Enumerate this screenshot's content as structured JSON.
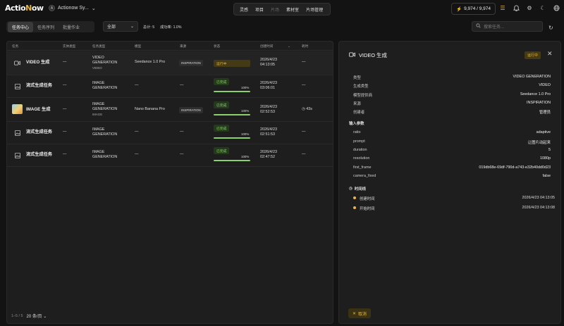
{
  "app": {
    "logo_prefix": "Actio",
    "logo_n": "N",
    "logo_suffix": "ow",
    "workspace_initial": "A",
    "workspace_name": "Actionow Sy..."
  },
  "nav": {
    "items": [
      "灵感",
      "项目",
      "片场",
      "素材室",
      "片场管理"
    ]
  },
  "credits": {
    "value": "9,974 / 9,974"
  },
  "toolbar": {
    "tabs": [
      "任务中心",
      "任务序列",
      "批量作业"
    ],
    "filter": "全部",
    "stats_total": "总计: 5",
    "stats_success": "成功率: 1.0%",
    "search_placeholder": "搜索任务..."
  },
  "table": {
    "headers": [
      "任务",
      "实体类型",
      "任务类型",
      "模型",
      "来源",
      "状态",
      "创建时间",
      "耗时"
    ],
    "rows": [
      {
        "name": "VIDEO 生成",
        "entity": "—",
        "type1": "VIDEO",
        "type2": "GENERATION",
        "type3": "VIDEO",
        "model": "Seedance 1.0 Pro",
        "source": "INSPIRATION",
        "status": "运行中",
        "date": "2026/4/23",
        "time": "04:13:05",
        "duration": "—"
      },
      {
        "name": "流式生成任务",
        "entity": "—",
        "type1": "IMAGE",
        "type2": "GENERATION",
        "type3": "",
        "model": "—",
        "source": "—",
        "status": "已完成",
        "progress": 100,
        "pct": "100%",
        "date": "2026/4/23",
        "time": "03:06:01",
        "duration": "—"
      },
      {
        "name": "IMAGE 生成",
        "entity": "—",
        "type1": "IMAGE",
        "type2": "GENERATION",
        "type3": "IMAGE",
        "model": "Nano Banana Pro",
        "source": "INSPIRATION",
        "status": "已完成",
        "progress": 100,
        "pct": "100%",
        "date": "2026/4/23",
        "time": "02:52:53",
        "duration": "43s"
      },
      {
        "name": "流式生成任务",
        "entity": "—",
        "type1": "IMAGE",
        "type2": "GENERATION",
        "type3": "",
        "model": "—",
        "source": "—",
        "status": "已完成",
        "progress": 100,
        "pct": "100%",
        "date": "2026/4/23",
        "time": "02:51:53",
        "duration": "—"
      },
      {
        "name": "流式生成任务",
        "entity": "—",
        "type1": "IMAGE",
        "type2": "GENERATION",
        "type3": "",
        "model": "—",
        "source": "—",
        "status": "已完成",
        "progress": 100,
        "pct": "100%",
        "date": "2026/4/23",
        "time": "02:47:52",
        "duration": "—"
      }
    ]
  },
  "pager": {
    "range": "1–5 / 5",
    "page_size": "20 条/页"
  },
  "detail": {
    "title": "VIDEO 生成",
    "badge": "运行中",
    "props": [
      {
        "k": "类型",
        "v": "VIDEO GENERATION"
      },
      {
        "k": "生成类型",
        "v": "VIDEO"
      },
      {
        "k": "模型提供商",
        "v": "Seedance 1.0 Pro"
      },
      {
        "k": "来源",
        "v": "INSPIRATION"
      },
      {
        "k": "创建者",
        "v": "管理员"
      }
    ],
    "params_title": "输入参数",
    "params": [
      {
        "k": "ratio",
        "v": "adaptive"
      },
      {
        "k": "prompt",
        "v": "让图片动起来"
      },
      {
        "k": "duration",
        "v": "5"
      },
      {
        "k": "resolution",
        "v": "1080p"
      },
      {
        "k": "first_frame",
        "v": "019db68e-69df-790d-a743-e32b40dd0d23"
      },
      {
        "k": "camera_fixed",
        "v": "false"
      }
    ],
    "timeline_title": "时间线",
    "timeline": [
      {
        "k": "创建时间",
        "v": "2026/4/23 04:13:05"
      },
      {
        "k": "开始时间",
        "v": "2026/4/23 04:13:08"
      }
    ],
    "cancel": "取消"
  }
}
